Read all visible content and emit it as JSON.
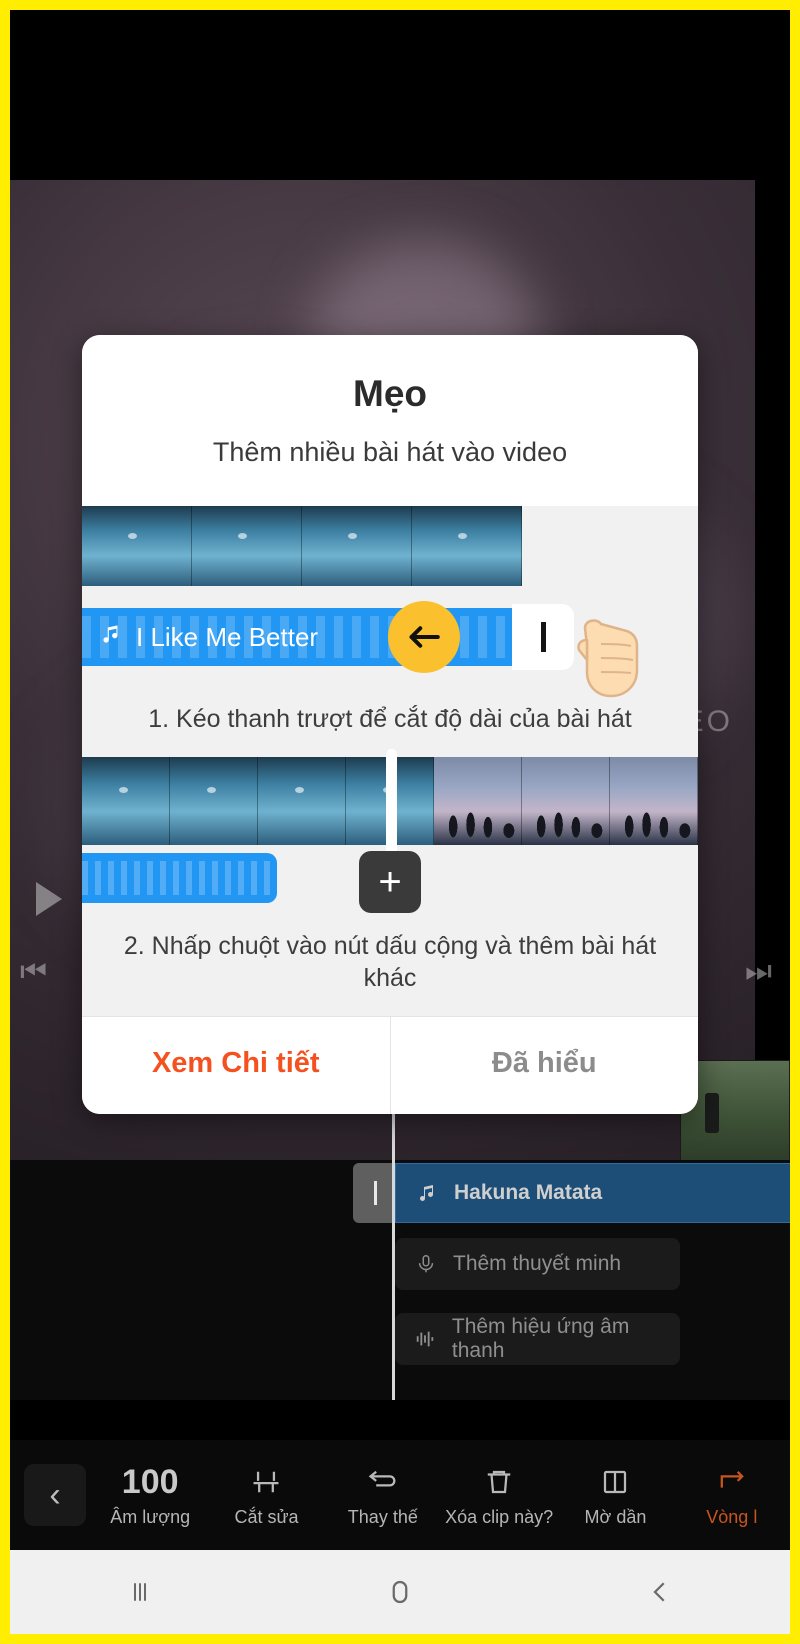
{
  "dialog": {
    "title": "Mẹo",
    "subtitle": "Thêm nhiều bài hát vào video",
    "music_track_label": "I Like Me Better",
    "music_icon": "music-note-icon",
    "arrow_icon": "arrow-left-icon",
    "step1_text": "1. Kéo thanh trượt để cắt độ dài của bài hát",
    "step2_text": "2. Nhấp chuột vào nút dấu cộng và thêm bài hát khác",
    "plus_label": "+",
    "primary_button": "Xem Chi tiết",
    "secondary_button": "Đã hiểu",
    "primary_color": "#f4511e",
    "secondary_color": "#8c8c8c",
    "accent_blue": "#2196f3",
    "accent_yellow": "#fbc02d"
  },
  "preview": {
    "watermark": "DEO",
    "play_icon": "play-icon",
    "skip_prev_icon": "skip-previous-icon",
    "skip_next_icon": "skip-next-icon"
  },
  "tracks": [
    {
      "label": "Hakuna Matata",
      "icon": "music-note-icon",
      "selected": true
    },
    {
      "label": "Thêm thuyết minh",
      "icon": "microphone-icon",
      "selected": false
    },
    {
      "label": "Thêm hiệu ứng âm thanh",
      "icon": "sound-wave-icon",
      "selected": false
    }
  ],
  "toolbar": {
    "back_icon": "chevron-left-icon",
    "items": [
      {
        "label": "Âm lượng",
        "icon": "volume-100-icon",
        "value": "100"
      },
      {
        "label": "Cắt sửa",
        "icon": "trim-icon"
      },
      {
        "label": "Thay thế",
        "icon": "replace-icon"
      },
      {
        "label": "Xóa clip này?",
        "icon": "trash-icon"
      },
      {
        "label": "Mờ dần",
        "icon": "fade-icon"
      },
      {
        "label": "Vòng l",
        "icon": "loop-on-icon",
        "badge": "ON"
      }
    ]
  },
  "navbar": {
    "recents": "recents-icon",
    "home": "home-icon",
    "back": "back-icon"
  }
}
